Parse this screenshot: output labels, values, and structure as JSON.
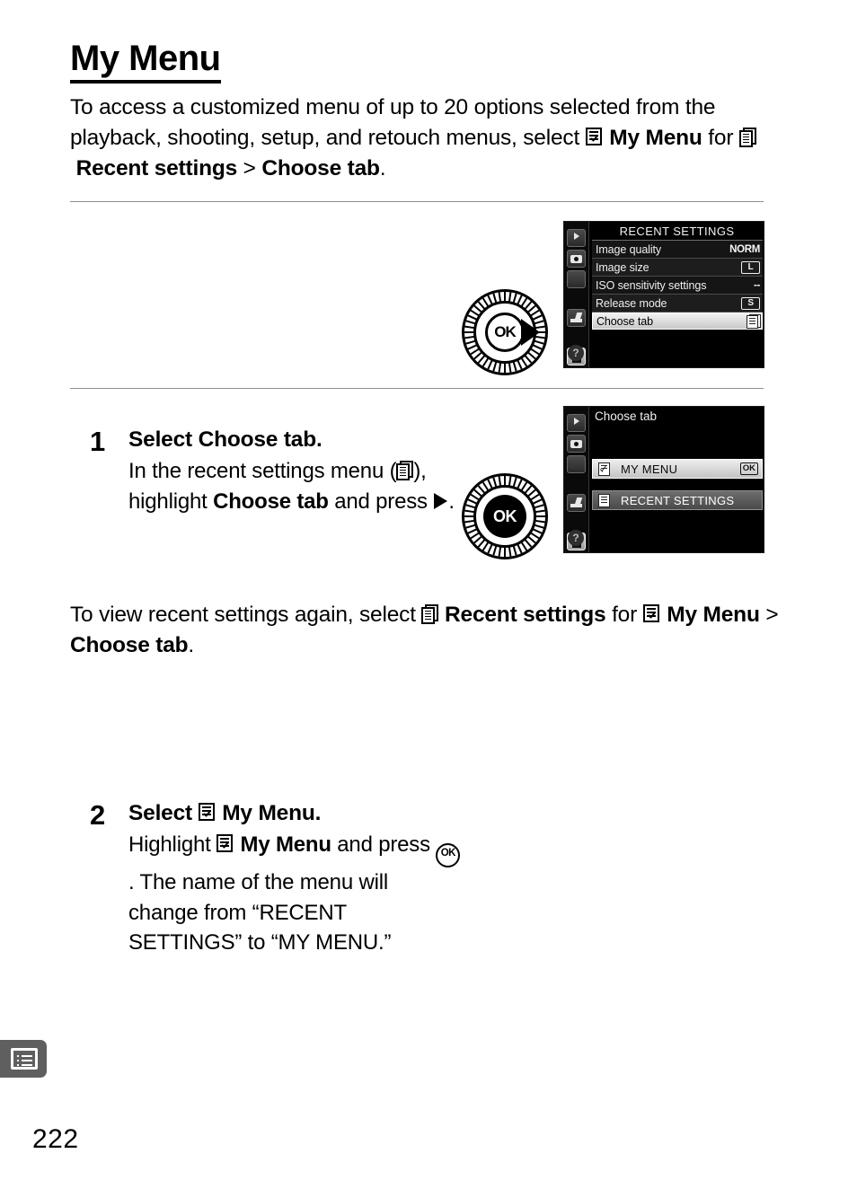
{
  "document": {
    "title": "My Menu",
    "page_number": "222",
    "intro_parts": {
      "t1": "To access a customized menu of up to 20 options selected from the playback, shooting, setup, and retouch menus, select ",
      "b1": "My Menu",
      "t2": " for ",
      "b2": "Recent settings",
      "t3": " > ",
      "b3": "Choose tab",
      "t4": "."
    },
    "outro_parts": {
      "t1": "To view recent settings again, select ",
      "b1": "Recent settings",
      "t2": " for ",
      "b2": "My Menu",
      "t3": " > ",
      "b3": "Choose tab",
      "t4": "."
    }
  },
  "steps": [
    {
      "number": "1",
      "heading_plain": "Select ",
      "heading_bold": "Choose tab.",
      "body_1": "In the recent settings menu (",
      "body_2": "), highlight ",
      "body_bold": "Choose tab",
      "body_3": " and press ",
      "body_4": ".",
      "dial": {
        "center_label": "OK",
        "direction": "right-arrow-icon"
      }
    },
    {
      "number": "2",
      "heading_plain": "Select ",
      "heading_bold": "My Menu.",
      "body_1": "Highlight ",
      "body_bold": "My Menu",
      "body_2": " and press ",
      "body_3": ".  The name of the menu will change from “RECENT SETTINGS” to “MY MENU.”",
      "dial": {
        "center_label": "OK",
        "direction": "ok-press"
      }
    }
  ],
  "lcd_screens": [
    {
      "title": "RECENT SETTINGS",
      "sidebar": [
        {
          "name": "playback-tab",
          "glyph": "play-icon",
          "active": false
        },
        {
          "name": "shooting-tab",
          "glyph": "camera-icon",
          "active": false
        },
        {
          "name": "setup-tab",
          "glyph": "wrench-icon",
          "active": false,
          "char": "⑂"
        },
        {
          "name": "retouch-tab",
          "glyph": "retouch-brush-icon",
          "active": false
        },
        {
          "name": "recent-settings-tab",
          "glyph": "document-icon",
          "active": true
        }
      ],
      "help_label": "?",
      "rows": [
        {
          "label": "Image quality",
          "value": "NORM",
          "value_type": "text",
          "selected": false
        },
        {
          "label": "Image size",
          "value": "L",
          "value_type": "box",
          "selected": false
        },
        {
          "label": "ISO sensitivity settings",
          "value": "--",
          "value_type": "text",
          "selected": false
        },
        {
          "label": "Release mode",
          "value": "S",
          "value_type": "box",
          "selected": false
        },
        {
          "label": "Choose tab",
          "value": "",
          "value_type": "doc-icon",
          "selected": true
        }
      ]
    },
    {
      "title": "Choose tab",
      "sidebar": [
        {
          "name": "playback-tab",
          "glyph": "play-icon",
          "active": false
        },
        {
          "name": "shooting-tab",
          "glyph": "camera-icon",
          "active": false
        },
        {
          "name": "setup-tab",
          "glyph": "wrench-icon",
          "active": false,
          "char": "⑂"
        },
        {
          "name": "retouch-tab",
          "glyph": "retouch-brush-icon",
          "active": false
        },
        {
          "name": "recent-settings-tab",
          "glyph": "document-icon",
          "active": true
        }
      ],
      "help_label": "?",
      "tab_options": [
        {
          "label": "MY MENU",
          "icon": "my-menu-icon",
          "selected": true,
          "badge": "OK"
        },
        {
          "label": "RECENT SETTINGS",
          "icon": "recent-settings-icon",
          "selected": false,
          "badge": ""
        }
      ]
    }
  ],
  "chapter_tab": {
    "icon": "menu-list-icon"
  },
  "colors": {
    "rule": "#8d8d8d",
    "lcd_background": "#000000",
    "highlight": "#e4e4e4",
    "chapter_tab": "#5f5f5f"
  }
}
